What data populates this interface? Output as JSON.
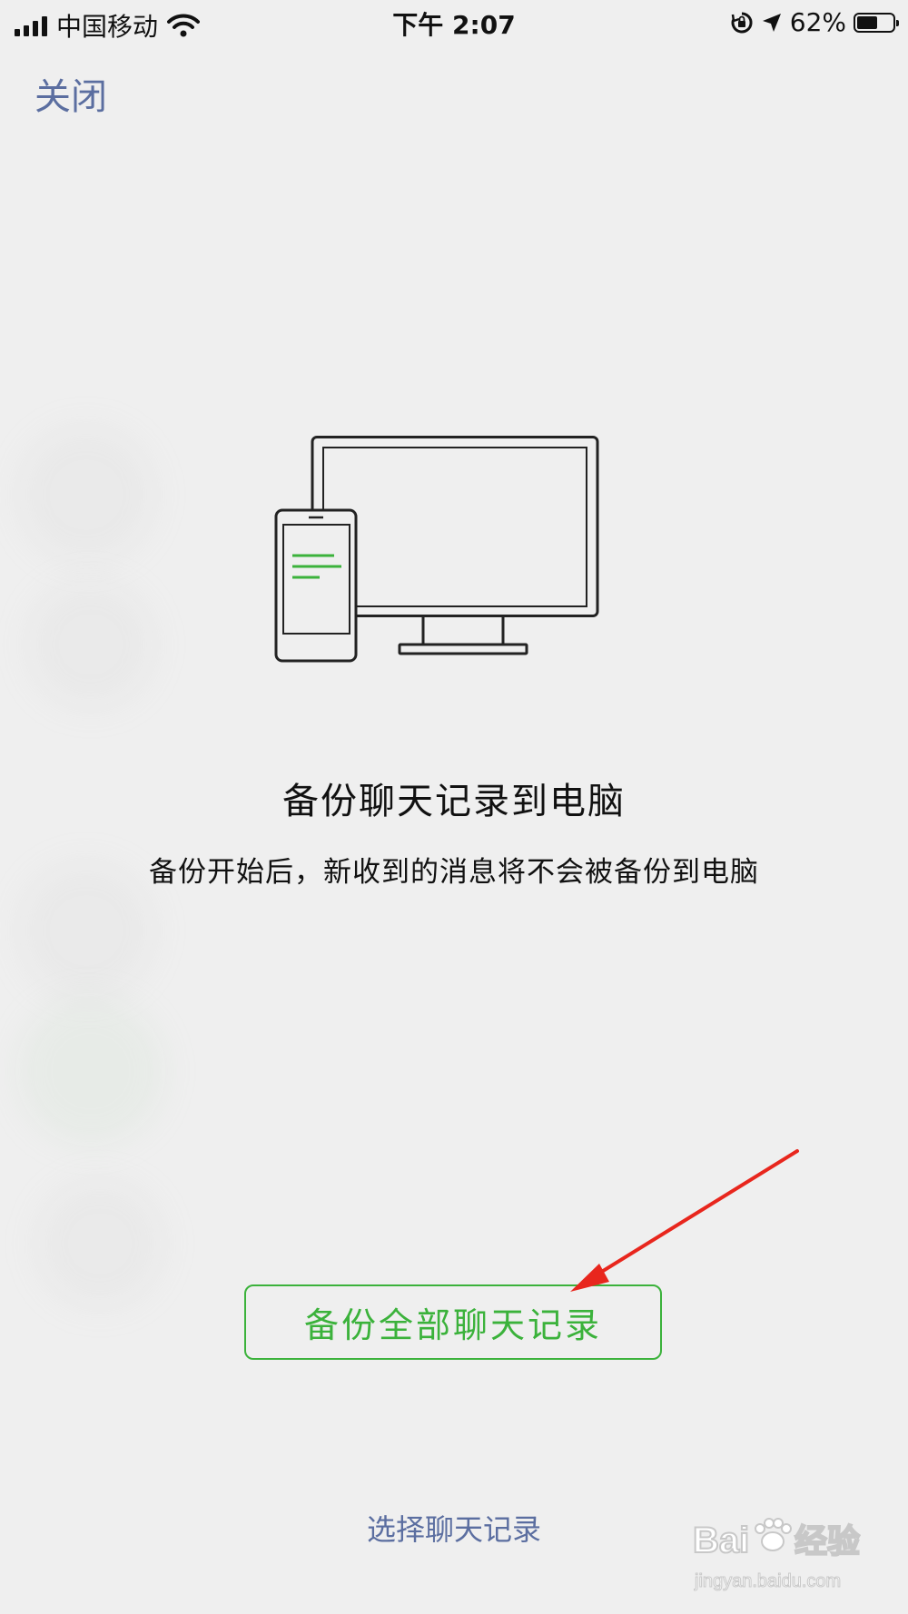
{
  "status_bar": {
    "carrier": "中国移动",
    "time": "下午 2:07",
    "battery_percent": "62%",
    "battery_level": 0.62,
    "icons": [
      "signal-icon",
      "wifi-icon",
      "rotation-lock-icon",
      "location-icon",
      "battery-icon"
    ]
  },
  "nav": {
    "close_label": "关闭"
  },
  "illustration": {
    "icon": "phone-to-computer-icon",
    "accent_color": "#3bb23b"
  },
  "main": {
    "title": "备份聊天记录到电脑",
    "subtitle": "备份开始后，新收到的消息将不会被备份到电脑",
    "primary_button": "备份全部聊天记录",
    "secondary_link": "选择聊天记录"
  },
  "annotation": {
    "arrow_color": "#e8261d"
  },
  "watermark": {
    "text": "Baidu经验",
    "url_text": "jingyan.baidu.com"
  },
  "colors": {
    "accent": "#3bb23b",
    "link": "#5b6ea0",
    "background": "#efefef"
  }
}
